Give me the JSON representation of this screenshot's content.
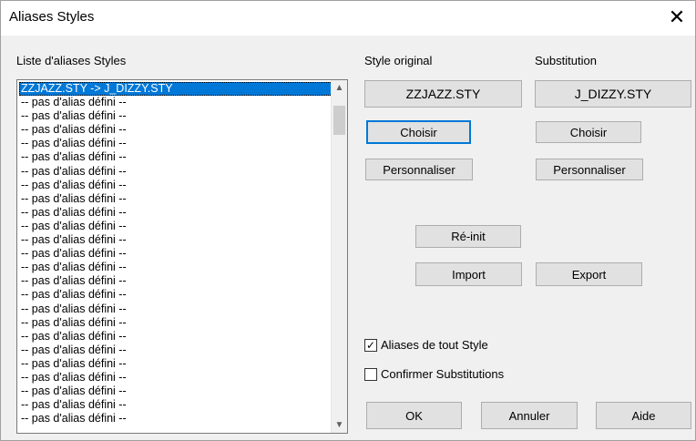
{
  "window": {
    "title": "Aliases Styles"
  },
  "list": {
    "label": "Liste d'aliases Styles",
    "items": [
      "ZZJAZZ.STY -> J_DIZZY.STY",
      "-- pas d'alias défini --",
      "-- pas d'alias défini --",
      "-- pas d'alias défini --",
      "-- pas d'alias défini --",
      "-- pas d'alias défini --",
      "-- pas d'alias défini --",
      "-- pas d'alias défini --",
      "-- pas d'alias défini --",
      "-- pas d'alias défini --",
      "-- pas d'alias défini --",
      "-- pas d'alias défini --",
      "-- pas d'alias défini --",
      "-- pas d'alias défini --",
      "-- pas d'alias défini --",
      "-- pas d'alias défini --",
      "-- pas d'alias défini --",
      "-- pas d'alias défini --",
      "-- pas d'alias défini --",
      "-- pas d'alias défini --",
      "-- pas d'alias défini --",
      "-- pas d'alias défini --",
      "-- pas d'alias défini --",
      "-- pas d'alias défini --",
      "-- pas d'alias défini --"
    ],
    "selected_index": 0
  },
  "original": {
    "label": "Style original",
    "value": "ZZJAZZ.STY",
    "choose_label": "Choisir",
    "customize_label": "Personnaliser"
  },
  "substitution": {
    "label": "Substitution",
    "value": "J_DIZZY.STY",
    "choose_label": "Choisir",
    "customize_label": "Personnaliser"
  },
  "actions": {
    "reset_label": "Ré-init",
    "import_label": "Import",
    "export_label": "Export"
  },
  "options": {
    "all_styles": {
      "label": "Aliases de tout Style",
      "checked": true
    },
    "confirm": {
      "label": "Confirmer Substitutions",
      "checked": false
    }
  },
  "footer": {
    "ok_label": "OK",
    "cancel_label": "Annuler",
    "help_label": "Aide"
  }
}
